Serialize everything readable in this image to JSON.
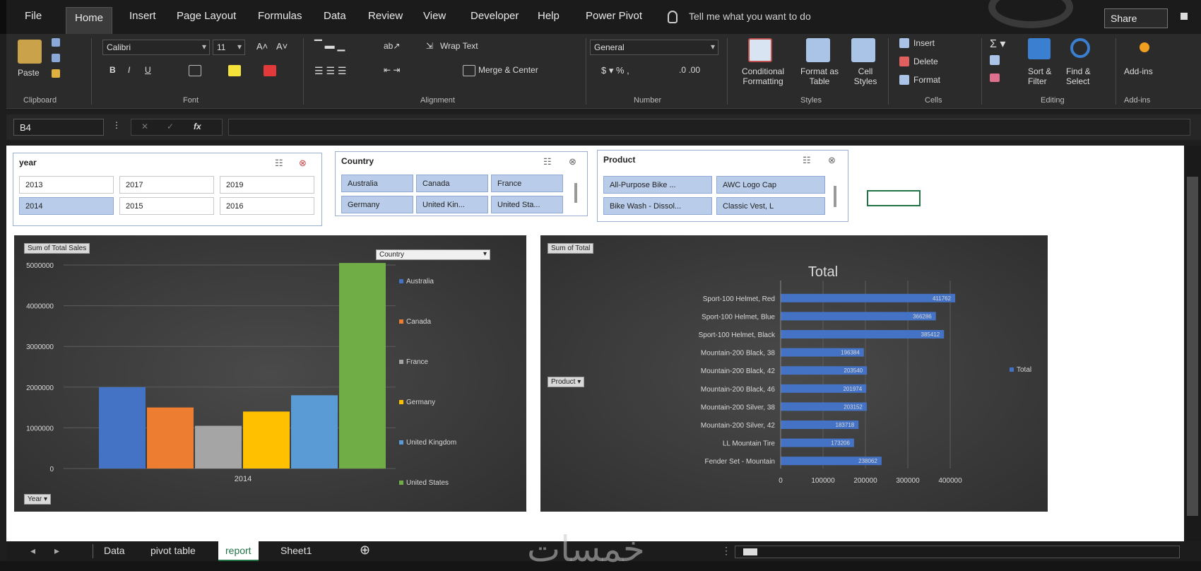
{
  "tabs": [
    "File",
    "Home",
    "Insert",
    "Page Layout",
    "Formulas",
    "Data",
    "Review",
    "View",
    "Developer",
    "Help",
    "Power Pivot"
  ],
  "active_tab": "Home",
  "tell_me": "Tell me what you want to do",
  "share": "Share",
  "ribbon": {
    "paste": "Paste",
    "font_name": "Calibri",
    "font_size": "11",
    "wrap_text": "Wrap Text",
    "merge_center": "Merge & Center",
    "number_format": "General",
    "conditional_formatting": "Conditional Formatting",
    "format_as_table": "Format as Table",
    "cell_styles": "Cell Styles",
    "insert": "Insert",
    "delete": "Delete",
    "format": "Format",
    "sort_filter": "Sort & Filter",
    "find_select": "Find & Select",
    "add_ins": "Add-ins",
    "groups": {
      "clipboard": "Clipboard",
      "font": "Font",
      "alignment": "Alignment",
      "number": "Number",
      "styles": "Styles",
      "cells": "Cells",
      "editing": "Editing",
      "add_ins": "Add-ins"
    }
  },
  "name_box": "B4",
  "slicers": {
    "year": {
      "title": "year",
      "items": [
        {
          "label": "2013",
          "selected": false
        },
        {
          "label": "2017",
          "selected": false
        },
        {
          "label": "2019",
          "selected": false
        },
        {
          "label": "2014",
          "selected": true
        },
        {
          "label": "2015",
          "selected": false
        },
        {
          "label": "2016",
          "selected": false
        }
      ]
    },
    "country": {
      "title": "Country",
      "items": [
        {
          "label": "Australia",
          "selected": true
        },
        {
          "label": "Canada",
          "selected": true
        },
        {
          "label": "France",
          "selected": true
        },
        {
          "label": "Germany",
          "selected": true
        },
        {
          "label": "United Kin...",
          "selected": true
        },
        {
          "label": "United Sta...",
          "selected": true
        }
      ]
    },
    "product": {
      "title": "Product",
      "items": [
        {
          "label": "All-Purpose Bike ...",
          "selected": true
        },
        {
          "label": "AWC Logo Cap",
          "selected": true
        },
        {
          "label": "Bike Wash - Dissol...",
          "selected": true
        },
        {
          "label": "Classic Vest, L",
          "selected": true
        }
      ]
    }
  },
  "chart_data": [
    {
      "type": "bar",
      "title": "",
      "field_button_values": "Sum of Total Sales",
      "field_button_country": "Country",
      "field_button_year": "Year",
      "categories": [
        "2014"
      ],
      "series": [
        {
          "name": "Australia",
          "values": [
            2000000
          ],
          "color": "#4472c4"
        },
        {
          "name": "Canada",
          "values": [
            1500000
          ],
          "color": "#ed7d31"
        },
        {
          "name": "France",
          "values": [
            1050000
          ],
          "color": "#a5a5a5"
        },
        {
          "name": "Germany",
          "values": [
            1400000
          ],
          "color": "#ffc000"
        },
        {
          "name": "United Kingdom",
          "values": [
            1800000
          ],
          "color": "#5b9bd5"
        },
        {
          "name": "United States",
          "values": [
            5050000
          ],
          "color": "#70ad47"
        }
      ],
      "y_ticks": [
        "0",
        "1000000",
        "2000000",
        "3000000",
        "4000000",
        "5000000"
      ],
      "ylim": [
        0,
        5000000
      ],
      "grid": true,
      "legend": "right"
    },
    {
      "type": "bar",
      "orientation": "horizontal",
      "title": "Total",
      "field_button_values": "Sum of Total",
      "field_button_rows": "Product",
      "categories": [
        "Sport-100 Helmet, Red",
        "Sport-100 Helmet, Blue",
        "Sport-100 Helmet, Black",
        "Mountain-200 Black, 38",
        "Mountain-200 Black, 42",
        "Mountain-200 Black, 46",
        "Mountain-200 Silver, 38",
        "Mountain-200 Silver, 42",
        "LL Mountain Tire",
        "Fender Set - Mountain"
      ],
      "series": [
        {
          "name": "Total",
          "values": [
            411762,
            366286,
            385412,
            196384,
            203540,
            201974,
            203152,
            183718,
            173206,
            238062
          ],
          "color": "#4472c4"
        }
      ],
      "x_ticks": [
        "0",
        "100000",
        "200000",
        "300000",
        "400000"
      ],
      "xlim": [
        0,
        400000
      ],
      "grid": true,
      "legend": "right"
    }
  ],
  "sheet_tabs": [
    "Data",
    "pivot table",
    "report",
    "Sheet1"
  ],
  "active_sheet": "report",
  "watermark": "خمسات"
}
